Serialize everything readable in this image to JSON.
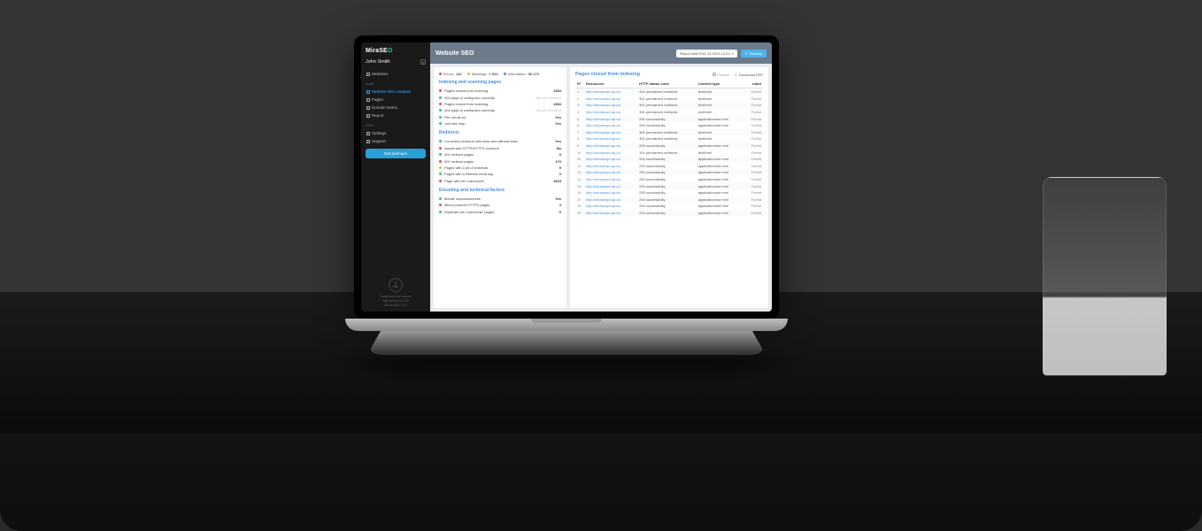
{
  "brand": {
    "name": "MiraSE",
    "accent": "O"
  },
  "user": {
    "name": "John Smith"
  },
  "nav": {
    "top": [
      {
        "label": "Websites",
        "name": "nav-websites"
      }
    ],
    "groups": [
      {
        "heading": "Audit",
        "items": [
          {
            "label": "Website SEO analysis",
            "name": "nav-website-seo",
            "active": true
          },
          {
            "label": "Pages",
            "name": "nav-pages"
          },
          {
            "label": "Domain metric",
            "name": "nav-domain-metric"
          },
          {
            "label": "Report",
            "name": "nav-report"
          }
        ]
      },
      {
        "heading": "Other",
        "items": [
          {
            "label": "Settings",
            "name": "nav-settings"
          },
          {
            "label": "Support",
            "name": "nav-support"
          }
        ]
      }
    ],
    "premium": "Get premium"
  },
  "gauge": {
    "pct": "0%"
  },
  "footer": {
    "l1": "Download new version",
    "l2": "App version 1.0.12",
    "l3": "API version 1.0.7"
  },
  "page": {
    "title": "Website SEO",
    "report_date": "Report date Feb. 24,2023 14:23",
    "refresh": "Refresh"
  },
  "stats": {
    "errors_label": "Errors:",
    "errors": "182",
    "warnings_label": "Warnings:",
    "warnings": "1 833",
    "info_label": "Information:",
    "info": "56 476"
  },
  "sections": [
    {
      "title": "Indexing and scanning pages",
      "rows": [
        {
          "dot": "red",
          "label": "Pages closed from indexing",
          "value": "1653"
        },
        {
          "dot": "grn",
          "label": "404 page is configured correctly",
          "value": "Not yet checked",
          "muted": true
        },
        {
          "dot": "red",
          "label": "Pages closed from indexing",
          "value": "1653"
        },
        {
          "dot": "grn",
          "label": "404 page is configured correctly",
          "value": "Not yet checked",
          "muted": true
        },
        {
          "dot": "grn",
          "label": "File robots.txt",
          "value": "Yes"
        },
        {
          "dot": "grn",
          "label": ".xml site map",
          "value": "Yes"
        }
      ]
    },
    {
      "title": "Redirects",
      "rows": [
        {
          "dot": "grn",
          "label": "Corrected versions with www and without www",
          "value": "Yes"
        },
        {
          "dot": "red",
          "label": "Issues with HTTP/HTTPS versions",
          "value": "No"
        },
        {
          "dot": "grn",
          "label": "302 redirect pages",
          "value": "0"
        },
        {
          "dot": "red",
          "label": "301 redirect pages",
          "value": "170"
        },
        {
          "dot": "yel",
          "label": "Pages with a lot of redirects",
          "value": "9"
        },
        {
          "dot": "grn",
          "label": "Pages with a Refresh meta tag",
          "value": "0"
        },
        {
          "dot": "red",
          "label": "Page with rel=\"canonical\"",
          "value": "1615"
        }
      ]
    },
    {
      "title": "Encoding and technical factors",
      "rows": [
        {
          "dot": "grn",
          "label": "Mobile responsiveness",
          "value": "Yes"
        },
        {
          "dot": "red",
          "label": "Mixed content HTTPS pages",
          "value": "3"
        },
        {
          "dot": "grn",
          "label": "Duplicate rel=\"canonical\" pages",
          "value": "0"
        }
      ]
    }
  ],
  "table": {
    "title": "Pages closed from indexing",
    "search_placeholder": "Search",
    "download": "Download PDF",
    "headers": {
      "idx": "Nº",
      "res": "Resources",
      "status": "HTTP status code",
      "ctype": "Content type",
      "robot": "robot"
    },
    "rows": [
      {
        "i": 1,
        "res": "http://miraseopr.qa.ua",
        "status": "301 permanent redirects",
        "ctype": "text/html",
        "robot": "Forbid"
      },
      {
        "i": 2,
        "res": "http://miraseopr.qa.ua",
        "status": "301 permanent redirects",
        "ctype": "text/html",
        "robot": "Forbid"
      },
      {
        "i": 3,
        "res": "http://miraseopr.qa.ua",
        "status": "301 permanent redirects",
        "ctype": "text/html",
        "robot": "Forbid"
      },
      {
        "i": 4,
        "res": "http://miraseopr.qa.ua",
        "status": "301 permanent redirects",
        "ctype": "text/html",
        "robot": "Forbid"
      },
      {
        "i": 5,
        "res": "http://miraseopr.qa.ua",
        "status": "200 successfully",
        "ctype": "application/rss+xml",
        "robot": "Forbid"
      },
      {
        "i": 6,
        "res": "http://miraseopr.qa.ua",
        "status": "200 successfully",
        "ctype": "application/rss+xml",
        "robot": "Forbid"
      },
      {
        "i": 7,
        "res": "http://miraseopr.qa.ua",
        "status": "301 permanent redirects",
        "ctype": "text/html",
        "robot": "Forbid"
      },
      {
        "i": 8,
        "res": "http://miraseopr.qa.ua",
        "status": "301 permanent redirects",
        "ctype": "text/html",
        "robot": "Forbid"
      },
      {
        "i": 9,
        "res": "http://miraseopr.qa.ua",
        "status": "200 successfully",
        "ctype": "application/rss+xml",
        "robot": "Forbid"
      },
      {
        "i": 10,
        "res": "http://miraseopr.qa.ua",
        "status": "301 permanent redirects",
        "ctype": "text/html",
        "robot": "Forbid"
      },
      {
        "i": 11,
        "res": "http://miraseopr.qa.ua",
        "status": "200 successfully",
        "ctype": "application/rss+xml",
        "robot": "Forbid"
      },
      {
        "i": 12,
        "res": "http://miraseopr.qa.ua",
        "status": "200 successfully",
        "ctype": "application/rss+xml",
        "robot": "Forbid"
      },
      {
        "i": 13,
        "res": "http://miraseopr.qa.ua",
        "status": "200 successfully",
        "ctype": "application/rss+xml",
        "robot": "Forbid"
      },
      {
        "i": 14,
        "res": "http://miraseopr.qa.ua",
        "status": "200 successfully",
        "ctype": "application/rss+xml",
        "robot": "Forbid"
      },
      {
        "i": 15,
        "res": "http://miraseopr.qa.ua",
        "status": "200 successfully",
        "ctype": "application/rss+xml",
        "robot": "Forbid"
      },
      {
        "i": 16,
        "res": "http://miraseopr.qa.ua",
        "status": "200 successfully",
        "ctype": "application/rss+xml",
        "robot": "Forbid"
      },
      {
        "i": 17,
        "res": "http://miraseopr.qa.ua",
        "status": "200 successfully",
        "ctype": "application/rss+xml",
        "robot": "Forbid"
      },
      {
        "i": 18,
        "res": "http://miraseopr.qa.ua",
        "status": "200 successfully",
        "ctype": "application/rss+xml",
        "robot": "Forbid"
      },
      {
        "i": 19,
        "res": "http://miraseopr.qa.ua",
        "status": "200 successfully",
        "ctype": "application/rss+xml",
        "robot": "Forbid"
      }
    ]
  }
}
